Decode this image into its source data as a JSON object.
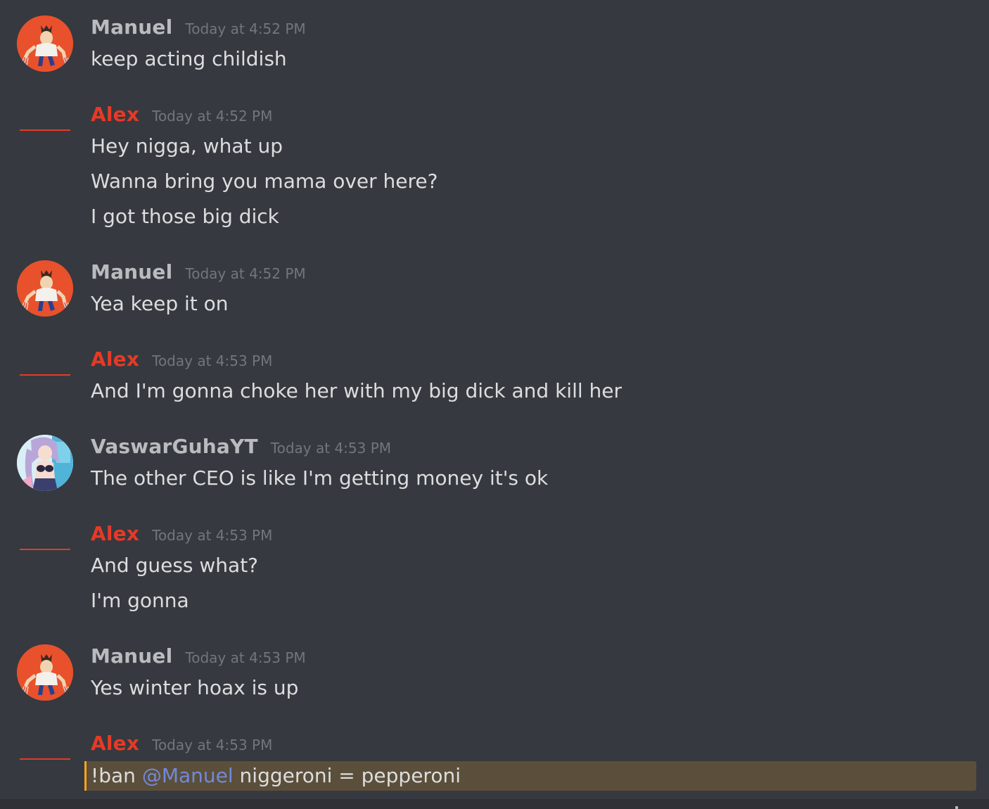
{
  "colors": {
    "background": "#36393f",
    "manuel_name": "#b9bbbe",
    "alex_name": "#e53a26",
    "vaswar_name": "#b9bbbe",
    "timestamp": "#72767d",
    "message_text": "#dcddde",
    "mention": "#7289da",
    "highlight_bg": "#5b4f3b",
    "highlight_border": "#faa61a"
  },
  "messages": [
    {
      "author": "Manuel",
      "avatar": "wolverine-avatar-icon",
      "timestamp": "Today at 4:52 PM",
      "lines": [
        "keep acting childish"
      ]
    },
    {
      "author": "Alex",
      "avatar": "red-line",
      "timestamp": "Today at 4:52 PM",
      "lines": [
        "Hey nigga, what up",
        "Wanna bring you mama over here?",
        "I got those big dick"
      ]
    },
    {
      "author": "Manuel",
      "avatar": "wolverine-avatar-icon",
      "timestamp": "Today at 4:52 PM",
      "lines": [
        "Yea keep it on"
      ]
    },
    {
      "author": "Alex",
      "avatar": "red-line",
      "timestamp": "Today at 4:53 PM",
      "lines": [
        "And I'm gonna choke her with my big dick and kill her"
      ]
    },
    {
      "author": "VaswarGuhaYT",
      "avatar": "anime-avatar-icon",
      "timestamp": "Today at 4:53 PM",
      "lines": [
        "The other CEO is like I'm getting money it's ok"
      ]
    },
    {
      "author": "Alex",
      "avatar": "red-line",
      "timestamp": "Today at 4:53 PM",
      "lines": [
        "And guess what?",
        "I'm gonna"
      ]
    },
    {
      "author": "Manuel",
      "avatar": "wolverine-avatar-icon",
      "timestamp": "Today at 4:53 PM",
      "lines": [
        "Yes winter hoax is up"
      ]
    },
    {
      "author": "Alex",
      "avatar": "red-line",
      "timestamp": "Today at 4:53 PM",
      "highlighted_line": {
        "prefix": "!ban ",
        "mention": "@Manuel",
        "suffix": " niggeroni = pepperoni"
      }
    }
  ]
}
